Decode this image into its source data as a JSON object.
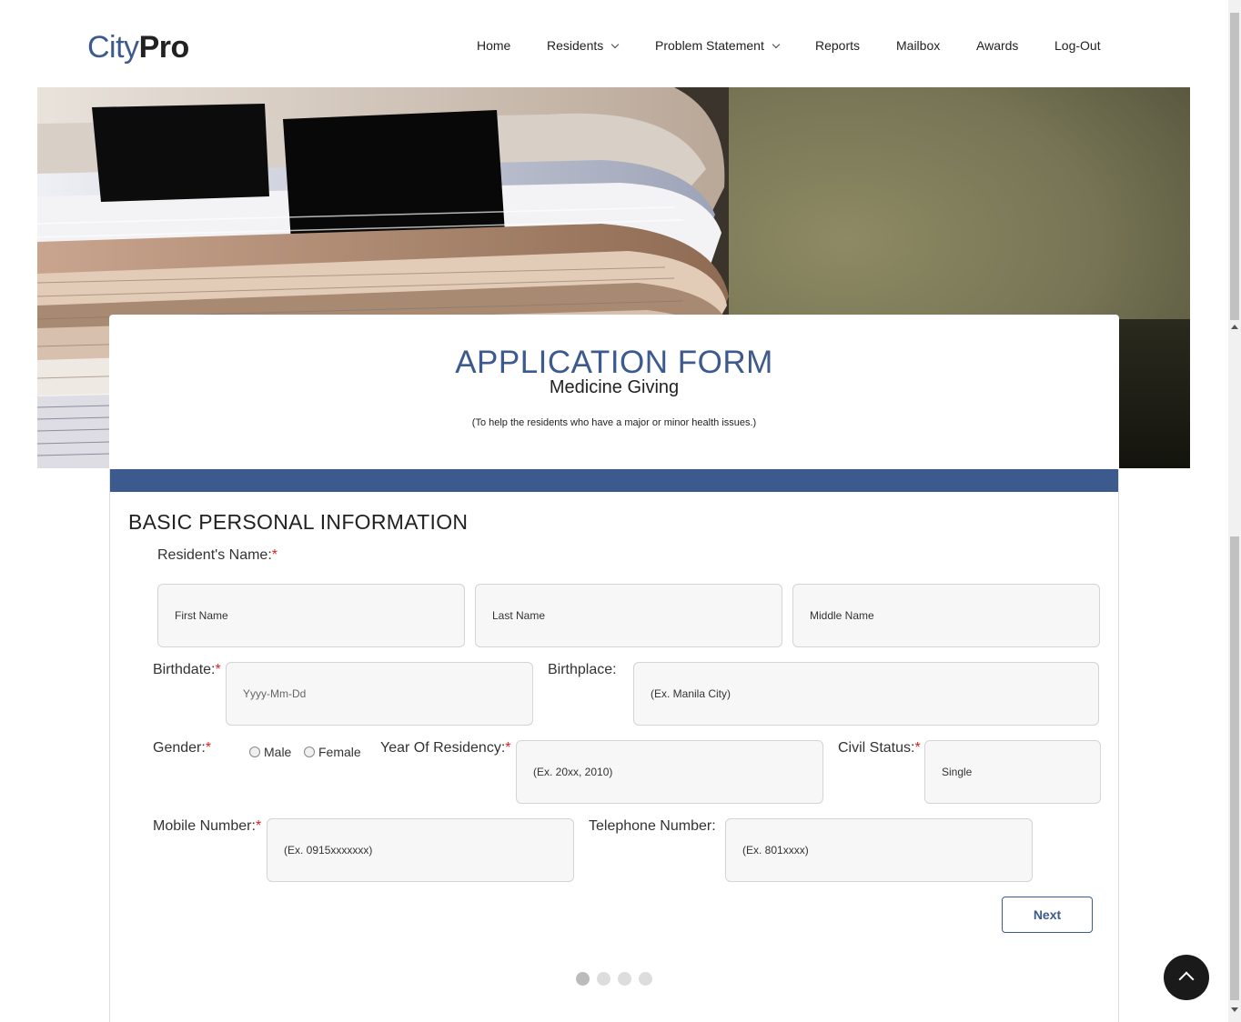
{
  "brand": {
    "city": "City",
    "pro": "Pro"
  },
  "nav": {
    "home": "Home",
    "residents": "Residents",
    "problem_statement": "Problem Statement",
    "reports": "Reports",
    "mailbox": "Mailbox",
    "awards": "Awards",
    "logout": "Log-Out"
  },
  "title": {
    "heading": "APPLICATION FORM",
    "subheading": "Medicine Giving",
    "description": "(To help the residents who have a major or minor health issues.)"
  },
  "form": {
    "section_title": "BASIC PERSONAL INFORMATION",
    "required_mark": "*",
    "residents_name_label": "Resident's Name:",
    "first_name_placeholder": "First Name",
    "last_name_placeholder": "Last Name",
    "middle_name_placeholder": "Middle Name",
    "birthdate_label": "Birthdate:",
    "birthdate_placeholder": "Yyyy-Mm-Dd",
    "birthplace_label": "Birthplace:",
    "birthplace_placeholder": "(Ex. Manila City)",
    "gender_label": "Gender:",
    "gender_male": "Male",
    "gender_female": "Female",
    "year_residency_label": "Year Of Residency:",
    "year_residency_placeholder": "(Ex. 20xx, 2010)",
    "civil_status_label": "Civil Status:",
    "civil_status_value": "Single",
    "mobile_label": "Mobile Number:",
    "mobile_placeholder": "(Ex. 0915xxxxxxx)",
    "telephone_label": "Telephone Number:",
    "telephone_placeholder": "(Ex. 801xxxx)",
    "next_button": "Next"
  },
  "colors": {
    "brand": "#3d5a8f",
    "required": "#e02020"
  },
  "icons": {
    "scroll_top": "chevron-up-icon",
    "dropdown": "chevron-down-icon"
  }
}
